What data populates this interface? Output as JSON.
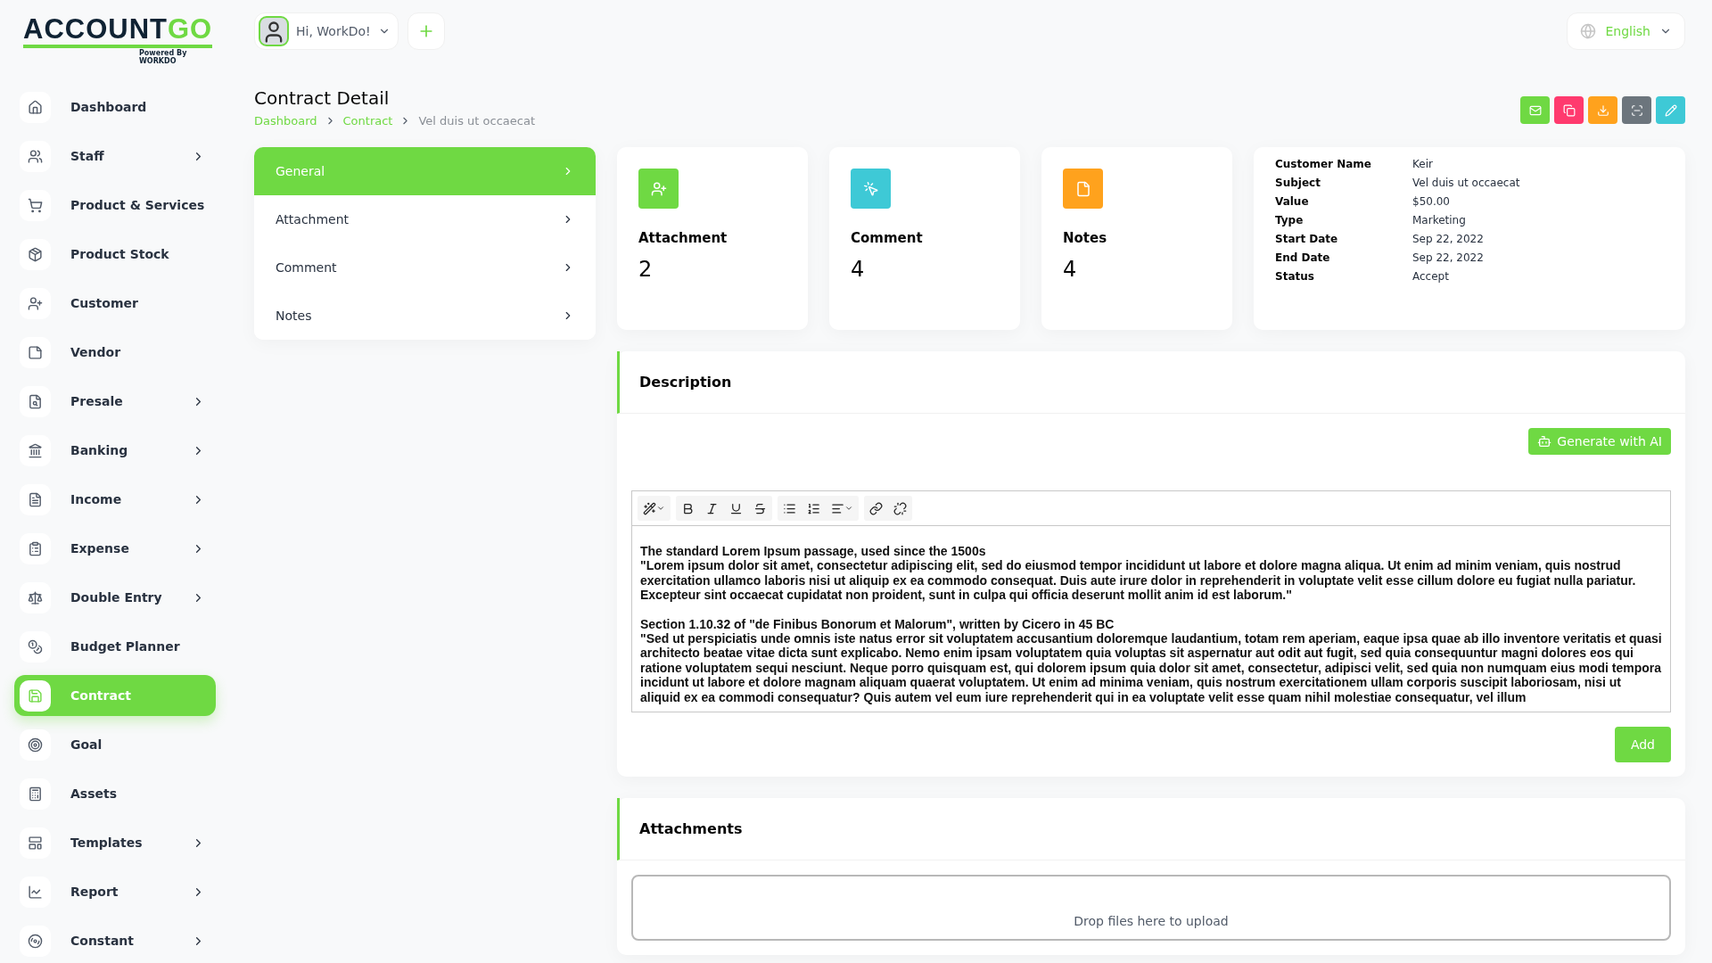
{
  "logo": {
    "primary": "ACCOUNT",
    "accent": "GO",
    "tagline": "Powered By WORKDO"
  },
  "header": {
    "greeting": "Hi, WorkDo!",
    "language": "English"
  },
  "sidebar": {
    "items": [
      {
        "label": "Dashboard",
        "expandable": false,
        "selected": false
      },
      {
        "label": "Staff",
        "expandable": true,
        "selected": false
      },
      {
        "label": "Product & Services",
        "expandable": false,
        "selected": false
      },
      {
        "label": "Product Stock",
        "expandable": false,
        "selected": false
      },
      {
        "label": "Customer",
        "expandable": false,
        "selected": false
      },
      {
        "label": "Vendor",
        "expandable": false,
        "selected": false
      },
      {
        "label": "Presale",
        "expandable": true,
        "selected": false
      },
      {
        "label": "Banking",
        "expandable": true,
        "selected": false
      },
      {
        "label": "Income",
        "expandable": true,
        "selected": false
      },
      {
        "label": "Expense",
        "expandable": true,
        "selected": false
      },
      {
        "label": "Double Entry",
        "expandable": true,
        "selected": false
      },
      {
        "label": "Budget Planner",
        "expandable": false,
        "selected": false
      },
      {
        "label": "Contract",
        "expandable": false,
        "selected": true
      },
      {
        "label": "Goal",
        "expandable": false,
        "selected": false
      },
      {
        "label": "Assets",
        "expandable": false,
        "selected": false
      },
      {
        "label": "Templates",
        "expandable": true,
        "selected": false
      },
      {
        "label": "Report",
        "expandable": true,
        "selected": false
      },
      {
        "label": "Constant",
        "expandable": true,
        "selected": false
      }
    ]
  },
  "page": {
    "title": "Contract Detail",
    "breadcrumb": [
      "Dashboard",
      "Contract",
      "Vel duis ut occaecat"
    ]
  },
  "actions": [
    {
      "color": "#6fd943"
    },
    {
      "color": "#ff3a6e"
    },
    {
      "color": "#ffa21d"
    },
    {
      "color": "#6c757d"
    },
    {
      "color": "#3ec9d6"
    }
  ],
  "tabs": [
    {
      "label": "General",
      "selected": true
    },
    {
      "label": "Attachment",
      "selected": false
    },
    {
      "label": "Comment",
      "selected": false
    },
    {
      "label": "Notes",
      "selected": false
    }
  ],
  "stats": [
    {
      "label": "Attachment",
      "value": "2",
      "color": "#6fd943"
    },
    {
      "label": "Comment",
      "value": "4",
      "color": "#3ec9d6"
    },
    {
      "label": "Notes",
      "value": "4",
      "color": "#ffa21d"
    }
  ],
  "details": [
    {
      "label": "Customer Name",
      "value": "Keir"
    },
    {
      "label": "Subject",
      "value": "Vel duis ut occaecat"
    },
    {
      "label": "Value",
      "value": "$50.00"
    },
    {
      "label": "Type",
      "value": "Marketing"
    },
    {
      "label": "Start Date",
      "value": "Sep 22, 2022"
    },
    {
      "label": "End Date",
      "value": "Sep 22, 2022"
    },
    {
      "label": "Status",
      "value": "Accept"
    }
  ],
  "description": {
    "title": "Description",
    "ai_button": "Generate with AI",
    "add_button": "Add",
    "blocks": [
      {
        "heading": "The standard Lorem Ipsum passage, used since the 1500s",
        "body": "\"Lorem ipsum dolor sit amet, consectetur adipiscing elit, sed do eiusmod tempor incididunt ut labore et dolore magna aliqua. Ut enim ad minim veniam, quis nostrud exercitation ullamco laboris nisi ut aliquip ex ea commodo consequat. Duis aute irure dolor in reprehenderit in voluptate velit esse cillum dolore eu fugiat nulla pariatur. Excepteur sint occaecat cupidatat non proident, sunt in culpa qui officia deserunt mollit anim id est laborum.\""
      },
      {
        "heading": "Section 1.10.32 of \"de Finibus Bonorum et Malorum\", written by Cicero in 45 BC",
        "body": "\"Sed ut perspiciatis unde omnis iste natus error sit voluptatem accusantium doloremque laudantium, totam rem aperiam, eaque ipsa quae ab illo inventore veritatis et quasi architecto beatae vitae dicta sunt explicabo. Nemo enim ipsam voluptatem quia voluptas sit aspernatur aut odit aut fugit, sed quia consequuntur magni dolores eos qui ratione voluptatem sequi nesciunt. Neque porro quisquam est, qui dolorem ipsum quia dolor sit amet, consectetur, adipisci velit, sed quia non numquam eius modi tempora incidunt ut labore et dolore magnam aliquam quaerat voluptatem. Ut enim ad minima veniam, quis nostrum exercitationem ullam corporis suscipit laboriosam, nisi ut aliquid ex ea commodi consequatur? Quis autem vel eum iure reprehenderit qui in ea voluptate velit esse quam nihil molestiae consequatur, vel illum"
      }
    ]
  },
  "attachments": {
    "title": "Attachments",
    "dropzone": "Drop files here to upload"
  }
}
